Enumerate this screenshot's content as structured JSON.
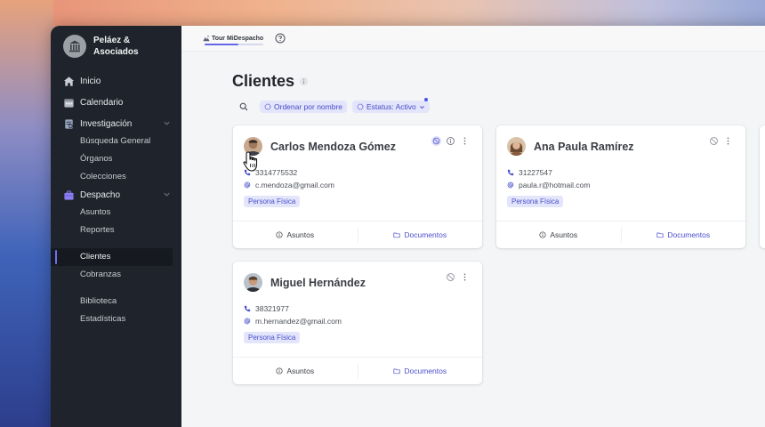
{
  "brand": {
    "name": "Peláez & Asociados"
  },
  "sidebar": {
    "items": [
      {
        "label": "Inicio",
        "icon": "home-icon"
      },
      {
        "label": "Calendario",
        "icon": "calendar-icon"
      },
      {
        "label": "Investigación",
        "icon": "document-icon",
        "expanded": true,
        "children": [
          "Búsqueda General",
          "Órganos",
          "Colecciones"
        ]
      },
      {
        "label": "Despacho",
        "icon": "briefcase-icon",
        "expanded": true,
        "children": [
          "Asuntos",
          "Reportes"
        ]
      }
    ],
    "group2": [
      "Clientes",
      "Cobranzas"
    ],
    "group3": [
      "Biblioteca",
      "Estadísticas"
    ],
    "active": "Clientes"
  },
  "topbar": {
    "tour_label": "Tour MiDespacho",
    "tour_progress": 0.58
  },
  "page": {
    "title": "Clientes"
  },
  "filters": {
    "sort_label": "Ordenar por nombre",
    "status_label": "Estatus: Activo"
  },
  "clients": [
    {
      "name": "Carlos Mendoza Gómez",
      "phone": "3314775532",
      "email": "c.mendoza@gmail.com",
      "type": "Persona Física"
    },
    {
      "name": "Ana Paula Ramírez",
      "phone": "31227547",
      "email": "paula.r@hotmail.com",
      "type": "Persona Física"
    },
    {
      "name": "Miguel Hernández",
      "phone": "38321977",
      "email": "m.hernandez@gmail.com",
      "type": "Persona Física"
    }
  ],
  "card_actions": {
    "asuntos": "Asuntos",
    "documentos": "Documentos"
  },
  "colors": {
    "sidebar_bg": "#1f242c",
    "accent": "#5b5ee6",
    "chip_bg": "#e3e5fb"
  }
}
